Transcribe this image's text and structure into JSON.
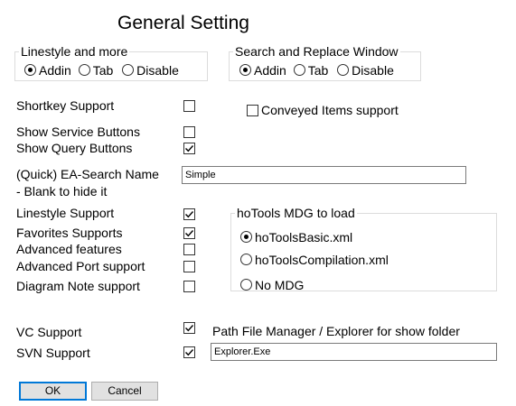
{
  "title": "General Setting",
  "linestyle_group": {
    "legend": "Linestyle and more",
    "options": [
      "Addin",
      "Tab",
      "Disable"
    ],
    "selected": "Addin"
  },
  "search_group": {
    "legend": "Search and Replace Window",
    "options": [
      "Addin",
      "Tab",
      "Disable"
    ],
    "selected": "Addin"
  },
  "checkboxes": {
    "shortkey": {
      "label": "Shortkey Support",
      "checked": false
    },
    "service_buttons": {
      "label": "Show Service Buttons",
      "checked": false
    },
    "query_buttons": {
      "label": "Show Query Buttons",
      "checked": true
    },
    "conveyed": {
      "label": "Conveyed Items support",
      "checked": false
    },
    "linestyle_support": {
      "label": "Linestyle Support",
      "checked": true
    },
    "favorites": {
      "label": "Favorites Supports",
      "checked": true
    },
    "advanced": {
      "label": "Advanced features",
      "checked": false
    },
    "advanced_port": {
      "label": "Advanced Port support",
      "checked": false
    },
    "diagram_note": {
      "label": "Diagram Note support",
      "checked": false
    },
    "vc": {
      "label": "VC Support",
      "checked": true
    },
    "svn": {
      "label": "SVN Support",
      "checked": true
    }
  },
  "ea_search": {
    "label_line1": "(Quick) EA-Search Name",
    "label_line2": "- Blank to hide it",
    "value": "Simple"
  },
  "mdg_group": {
    "legend": "hoTools MDG to load",
    "options": [
      "hoToolsBasic.xml",
      "hoToolsCompilation.xml",
      "No MDG"
    ],
    "selected": "hoToolsBasic.xml"
  },
  "path_manager": {
    "label": "Path File Manager / Explorer for show folder",
    "value": "Explorer.Exe"
  },
  "buttons": {
    "ok": "OK",
    "cancel": "Cancel"
  }
}
